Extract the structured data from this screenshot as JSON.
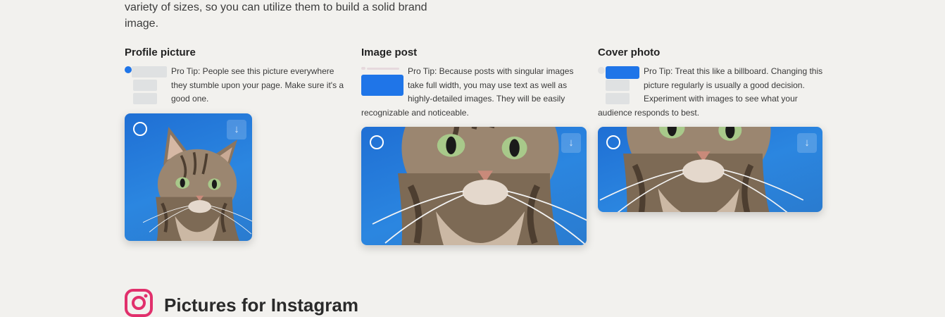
{
  "intro": {
    "text": "variety of sizes, so you can utilize them to build a solid brand image."
  },
  "cards": [
    {
      "title": "Profile picture",
      "tip": "Pro Tip: People see this picture everywhere they stumble upon your page. Make sure it's a good one."
    },
    {
      "title": "Image post",
      "tip": "Pro Tip: Because posts with singular images take full width, you may use text as well as highly-detailed images. They will be easily recognizable and noticeable."
    },
    {
      "title": "Cover photo",
      "tip": "Pro Tip: Treat this like a billboard. Changing this picture regularly is usually a good decision. Experiment with images to see what your audience responds to best."
    }
  ],
  "icons": {
    "download": "download-icon",
    "select": "select-circle-icon",
    "instagram": "instagram-icon"
  },
  "instagram_section": {
    "title": "Pictures for Instagram"
  },
  "colors": {
    "accent": "#1f75e8",
    "background": "#f2f1ee",
    "instagram": "#e1306c"
  }
}
